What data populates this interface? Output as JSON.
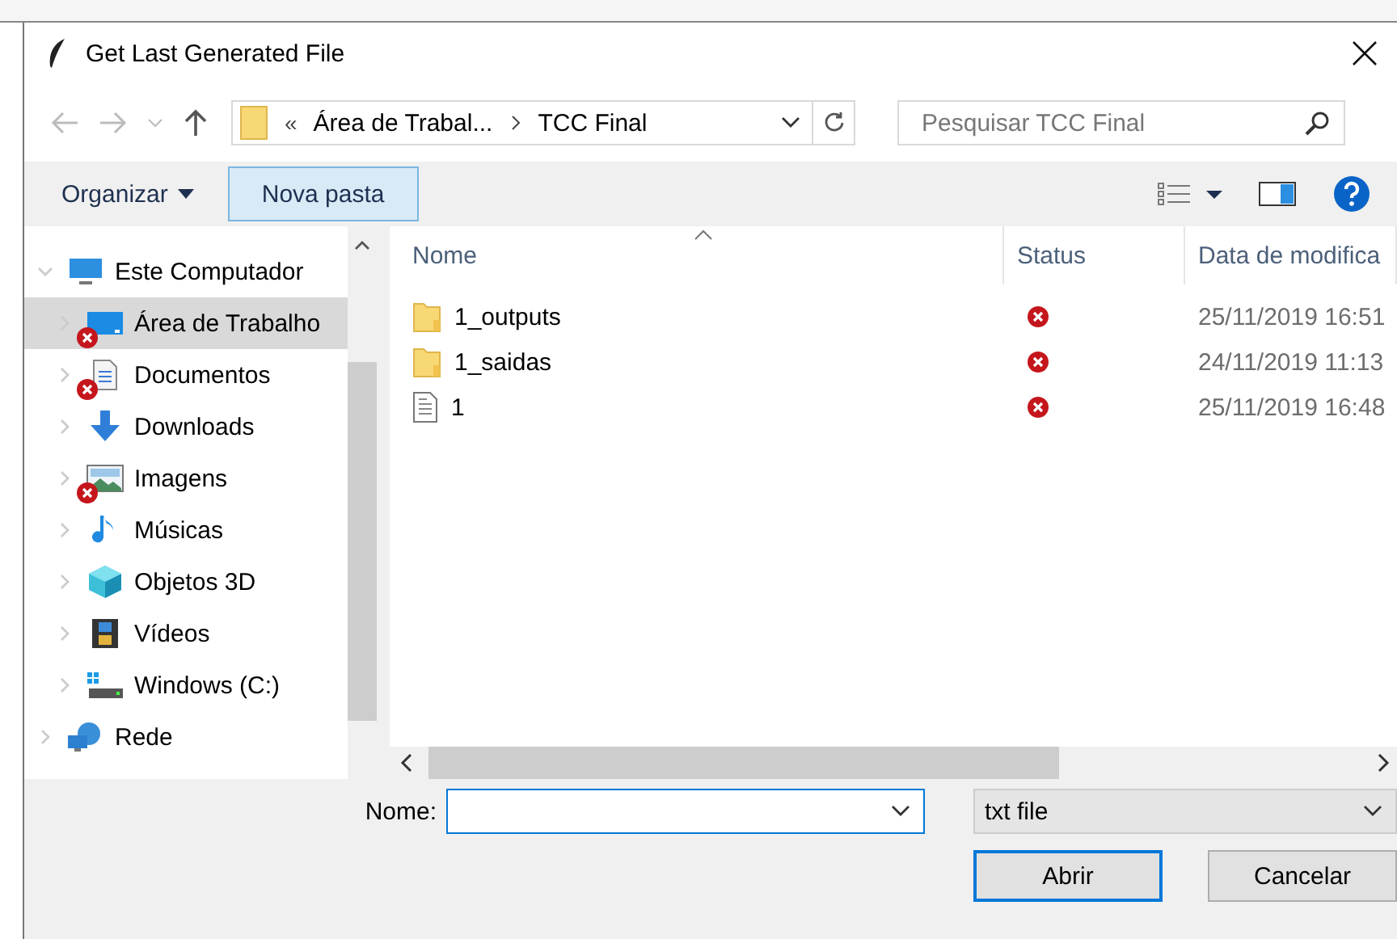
{
  "window": {
    "title": "Get Last Generated File"
  },
  "address": {
    "overflow": "«",
    "crumbs": [
      "Área de Trabal...",
      "TCC Final"
    ]
  },
  "search": {
    "placeholder": "Pesquisar TCC Final"
  },
  "toolbar": {
    "organize": "Organizar",
    "new_folder": "Nova pasta"
  },
  "sidebar": {
    "items": [
      {
        "label": "Este Computador",
        "kind": "computer",
        "expanded": true,
        "selected": false,
        "children": [
          {
            "label": "Área de Trabalho",
            "kind": "desktop",
            "selected": true,
            "expanded": false,
            "error": true
          },
          {
            "label": "Documentos",
            "kind": "documents",
            "selected": false,
            "expanded": false,
            "error": true
          },
          {
            "label": "Downloads",
            "kind": "downloads",
            "selected": false,
            "expanded": false,
            "error": false
          },
          {
            "label": "Imagens",
            "kind": "pictures",
            "selected": false,
            "expanded": false,
            "error": true
          },
          {
            "label": "Músicas",
            "kind": "music",
            "selected": false,
            "expanded": false,
            "error": false
          },
          {
            "label": "Objetos 3D",
            "kind": "objects",
            "selected": false,
            "expanded": false,
            "error": false
          },
          {
            "label": "Vídeos",
            "kind": "videos",
            "selected": false,
            "expanded": false,
            "error": false
          },
          {
            "label": "Windows (C:)",
            "kind": "drive",
            "selected": false,
            "expanded": false,
            "error": false
          }
        ]
      },
      {
        "label": "Rede",
        "kind": "network",
        "expanded": false,
        "selected": false
      }
    ]
  },
  "table": {
    "columns": [
      "Nome",
      "Status",
      "Data de modifica"
    ],
    "rows": [
      {
        "name": "1_outputs",
        "kind": "folder",
        "error": true,
        "date": "25/11/2019 16:51"
      },
      {
        "name": "1_saidas",
        "kind": "folder",
        "error": true,
        "date": "24/11/2019 11:13"
      },
      {
        "name": "1",
        "kind": "file",
        "error": true,
        "date": "25/11/2019 16:48"
      }
    ]
  },
  "filename": {
    "label": "Nome:"
  },
  "filter": {
    "value": "txt file"
  },
  "buttons": [
    "Abrir",
    "Cancelar"
  ]
}
